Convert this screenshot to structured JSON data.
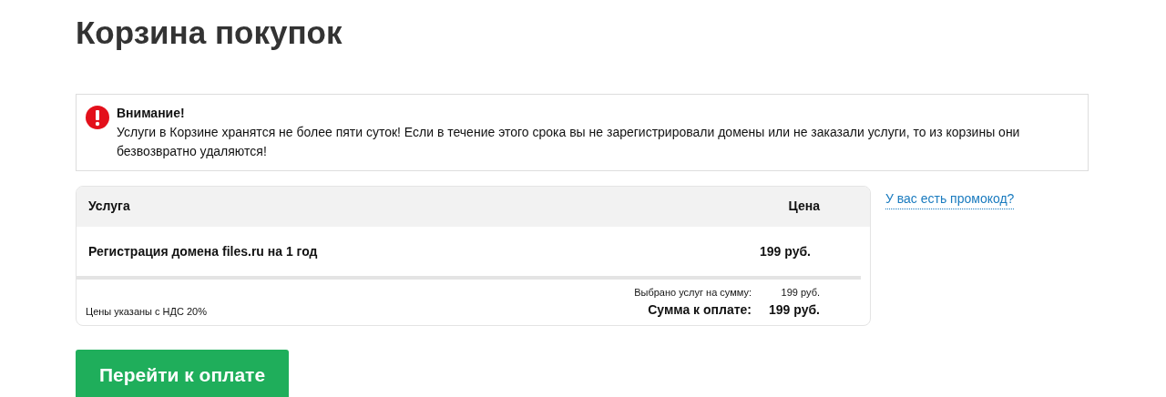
{
  "title": "Корзина покупок",
  "alert": {
    "heading": "Внимание!",
    "text": "Услуги в Корзине хранятся не более пяти суток! Если в течение этого срока вы не зарегистрировали домены или не заказали услуги, то из корзины они безвозвратно удаляются!"
  },
  "table": {
    "columns": [
      "Услуга",
      "Цена"
    ],
    "rows": [
      {
        "service": "Регистрация домена files.ru на 1 год",
        "price": "199 руб."
      }
    ],
    "vat_note": "Цены указаны с НДС 20%",
    "selected_label": "Выбрано услуг на сумму:",
    "selected_value": "199 руб.",
    "total_label": "Сумма к оплате:",
    "total_value": "199 руб."
  },
  "promo_link": "У вас есть промокод?",
  "pay_button": "Перейти к оплате"
}
